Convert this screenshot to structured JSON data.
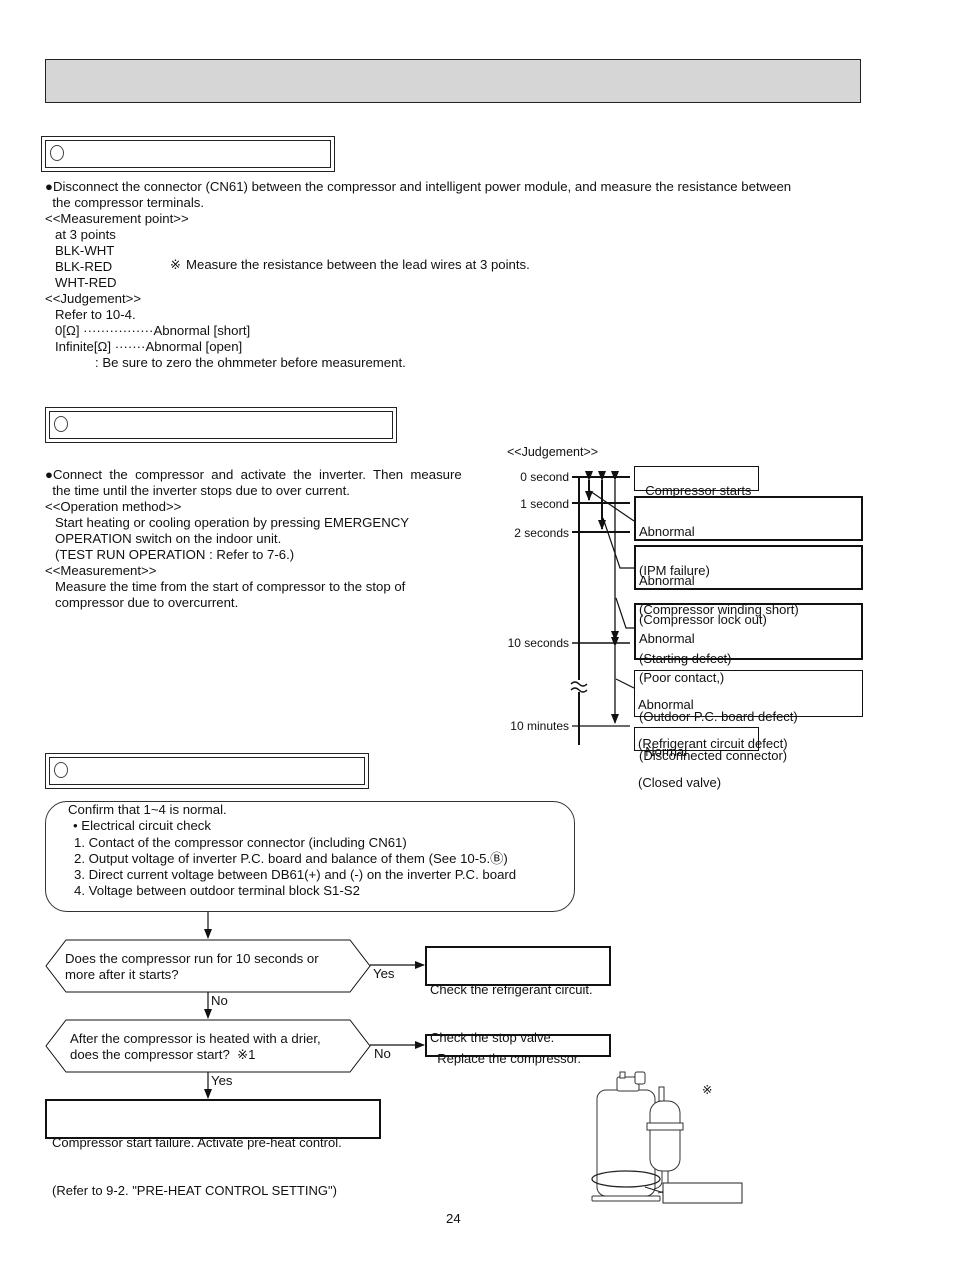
{
  "page": {
    "header_title": "",
    "page_number": "24"
  },
  "section1": {
    "title": "",
    "intro": [
      "●Disconnect the connector (CN61) between the compressor and intelligent power module, and measure the resistance between",
      "  the compressor terminals."
    ],
    "measurement_heading": "<<Measurement point>>",
    "measurement_points": [
      "at 3 points",
      "BLK-WHT",
      "BLK-RED",
      "WHT-RED"
    ],
    "note_symbol": "※",
    "note": "Measure the resistance between the lead wires at 3 points.",
    "judgement_heading": "<<Judgement>>",
    "judgement_lines": [
      "Refer to 10-4.",
      "0[Ω] ················Abnormal [short]",
      "Infinite[Ω] ·······Abnormal [open]"
    ],
    "zero_note": ": Be sure to zero the ohmmeter before measurement."
  },
  "section2": {
    "title": "",
    "intro": [
      "●Connect  the  compressor  and  activate  the  inverter.  Then  measure",
      "  the time until the inverter stops due to over current."
    ],
    "operation_heading": "<<Operation method>>",
    "operation_lines": [
      "Start heating or cooling operation by pressing EMERGENCY",
      "OPERATION switch on the indoor unit.",
      "(TEST RUN OPERATION : Refer to 7-6.)"
    ],
    "measurement_heading": "<<Measurement>>",
    "measurement_lines": [
      "Measure the time from the start of compressor to the stop of",
      "compressor due to overcurrent."
    ],
    "timing": {
      "heading": "<<Judgement>>",
      "ticks": [
        "0 second",
        "1 second",
        "2 seconds",
        "10 seconds",
        "10 minutes"
      ],
      "break_symbol": "≈",
      "results": [
        {
          "lines": [
            "Compressor starts"
          ]
        },
        {
          "lines": [
            "Abnormal",
            "(IPM failure)",
            "(Compressor winding short)"
          ]
        },
        {
          "lines": [
            "Abnormal",
            "(Compressor lock out)",
            "(Starting defect)"
          ]
        },
        {
          "lines": [
            "Abnormal",
            "(Poor contact,)",
            "(Outdoor P.C. board defect)",
            "(Disconnected connector)"
          ]
        },
        {
          "lines": [
            "Abnormal",
            "(Refrigerant circuit defect)",
            "(Closed valve)"
          ]
        },
        {
          "lines": [
            "Normal"
          ]
        }
      ]
    }
  },
  "section3": {
    "title": "",
    "confirm_box": {
      "heading": "Confirm that 1~4 is normal.",
      "bullet": "• Electrical circuit check",
      "items": [
        "1. Contact of the compressor connector (including CN61)",
        "2. Output voltage of inverter P.C. board and balance of them (See 10-5.Ⓑ)",
        "3. Direct current voltage between DB61(+) and (-) on the inverter P.C. board",
        "4. Voltage between outdoor terminal block S1-S2"
      ]
    },
    "decision1": {
      "question": [
        "Does the compressor run for 10 seconds or",
        "more after it starts?"
      ],
      "yes_label": "Yes",
      "no_label": "No",
      "yes_result": [
        "Check the refrigerant circuit.",
        "Check the stop valve."
      ]
    },
    "decision2": {
      "question": [
        "After the compressor is heated with a drier,",
        "does the compressor start?  ※1"
      ],
      "no_label": "No",
      "yes_label": "Yes",
      "no_result": "Replace the compressor.",
      "yes_result": [
        "Compressor start failure. Activate pre-heat control.",
        "(Refer to 9-2. \"PRE-HEAT CONTROL SETTING\")"
      ]
    },
    "illustration": {
      "note_symbol": "※",
      "callout_label": ""
    }
  }
}
